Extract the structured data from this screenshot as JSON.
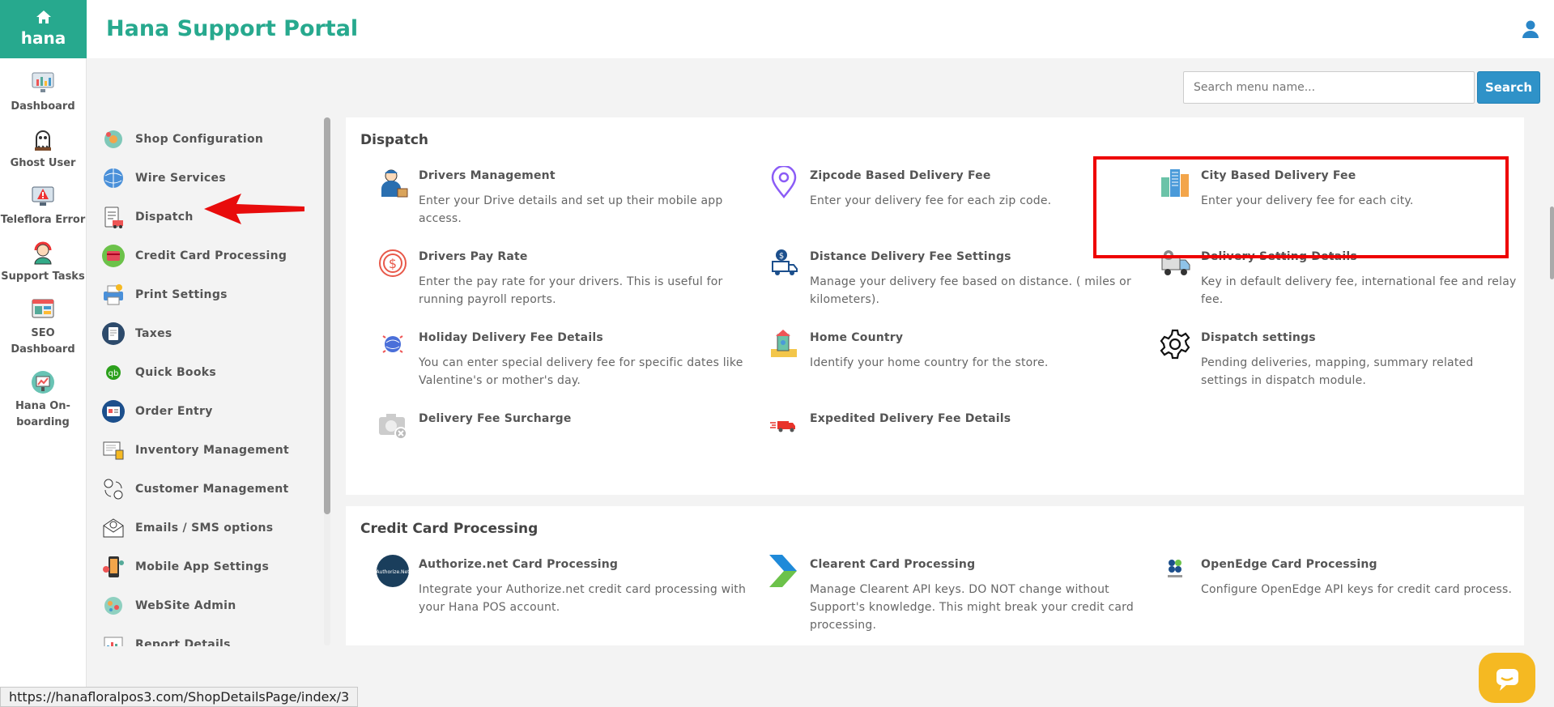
{
  "app": {
    "brand": "hana",
    "title": "Hana Support Portal"
  },
  "rail": {
    "items": [
      {
        "label": "Dashboard",
        "icon": "dashboard-icon"
      },
      {
        "label": "Ghost User",
        "icon": "ghost-user-icon"
      },
      {
        "label": "Teleflora Error",
        "icon": "teleflora-error-icon"
      },
      {
        "label": "Support Tasks",
        "icon": "support-tasks-icon"
      },
      {
        "label": "SEO Dashboard",
        "icon": "seo-dashboard-icon"
      },
      {
        "label": "Hana On-boarding",
        "icon": "onboarding-icon"
      }
    ]
  },
  "search": {
    "placeholder": "Search menu name...",
    "button_label": "Search"
  },
  "subnav": {
    "items": [
      {
        "label": "Shop Configuration",
        "icon": "shop-configuration-icon"
      },
      {
        "label": "Wire Services",
        "icon": "wire-services-icon"
      },
      {
        "label": "Dispatch",
        "icon": "dispatch-icon"
      },
      {
        "label": "Credit Card Processing",
        "icon": "credit-card-icon"
      },
      {
        "label": "Print Settings",
        "icon": "printer-icon"
      },
      {
        "label": "Taxes",
        "icon": "taxes-icon"
      },
      {
        "label": "Quick Books",
        "icon": "quickbooks-icon"
      },
      {
        "label": "Order Entry",
        "icon": "order-entry-icon"
      },
      {
        "label": "Inventory Management",
        "icon": "inventory-icon"
      },
      {
        "label": "Customer Management",
        "icon": "customer-management-icon"
      },
      {
        "label": "Emails / SMS options",
        "icon": "email-sms-icon"
      },
      {
        "label": "Mobile App Settings",
        "icon": "mobile-app-icon"
      },
      {
        "label": "WebSite Admin",
        "icon": "website-admin-icon"
      },
      {
        "label": "Report Details",
        "icon": "report-details-icon"
      }
    ]
  },
  "dispatch": {
    "title": "Dispatch",
    "cards": [
      {
        "name": "Drivers Management",
        "desc": "Enter your Drive details and set up their mobile app access.",
        "icon": "driver-icon"
      },
      {
        "name": "Zipcode Based Delivery Fee",
        "desc": "Enter your delivery fee for each zip code.",
        "icon": "location-pin-icon"
      },
      {
        "name": "City Based Delivery Fee",
        "desc": "Enter your delivery fee for each city.",
        "icon": "city-buildings-icon"
      },
      {
        "name": "Drivers Pay Rate",
        "desc": "Enter the pay rate for your drivers. This is useful for running payroll reports.",
        "icon": "dollar-cycle-icon"
      },
      {
        "name": "Distance Delivery Fee Settings",
        "desc": "Manage your delivery fee based on distance. ( miles or kilometers).",
        "icon": "delivery-truck-dollar-icon"
      },
      {
        "name": "Delivery Setting Details",
        "desc": "Key in default delivery fee, international fee and relay fee.",
        "icon": "truck-gear-icon"
      },
      {
        "name": "Holiday Delivery Fee Details",
        "desc": "You can enter special delivery fee for specific dates like Valentine's or mother's day.",
        "icon": "holiday-globe-icon"
      },
      {
        "name": "Home Country",
        "desc": "Identify your home country for the store.",
        "icon": "home-country-icon"
      },
      {
        "name": "Dispatch settings",
        "desc": "Pending deliveries, mapping, summary related settings in dispatch module.",
        "icon": "gear-icon"
      },
      {
        "name": "Delivery Fee Surcharge",
        "desc": "",
        "icon": "camera-icon"
      },
      {
        "name": "Expedited Delivery Fee Details",
        "desc": "",
        "icon": "fast-truck-icon"
      }
    ]
  },
  "credit_card": {
    "title": "Credit Card Processing",
    "cards": [
      {
        "name": "Authorize.net Card Processing",
        "desc": "Integrate your Authorize.net credit card processing with your Hana POS account.",
        "icon": "authorize-net-icon"
      },
      {
        "name": "Clearent Card Processing",
        "desc": "Manage Clearent API keys. DO NOT change without Support's knowledge. This might break your credit card processing.",
        "icon": "clearent-chevron-icon"
      },
      {
        "name": "OpenEdge Card Processing",
        "desc": "Configure OpenEdge API keys for credit card process.",
        "icon": "openedge-icon"
      }
    ]
  },
  "status_bar": {
    "url": "https://hanafloralpos3.com/ShopDetailsPage/index/3"
  },
  "colors": {
    "brand": "#27a98e",
    "search_button": "#2f92c8",
    "highlight": "#e00000",
    "chat": "#f5b922"
  }
}
